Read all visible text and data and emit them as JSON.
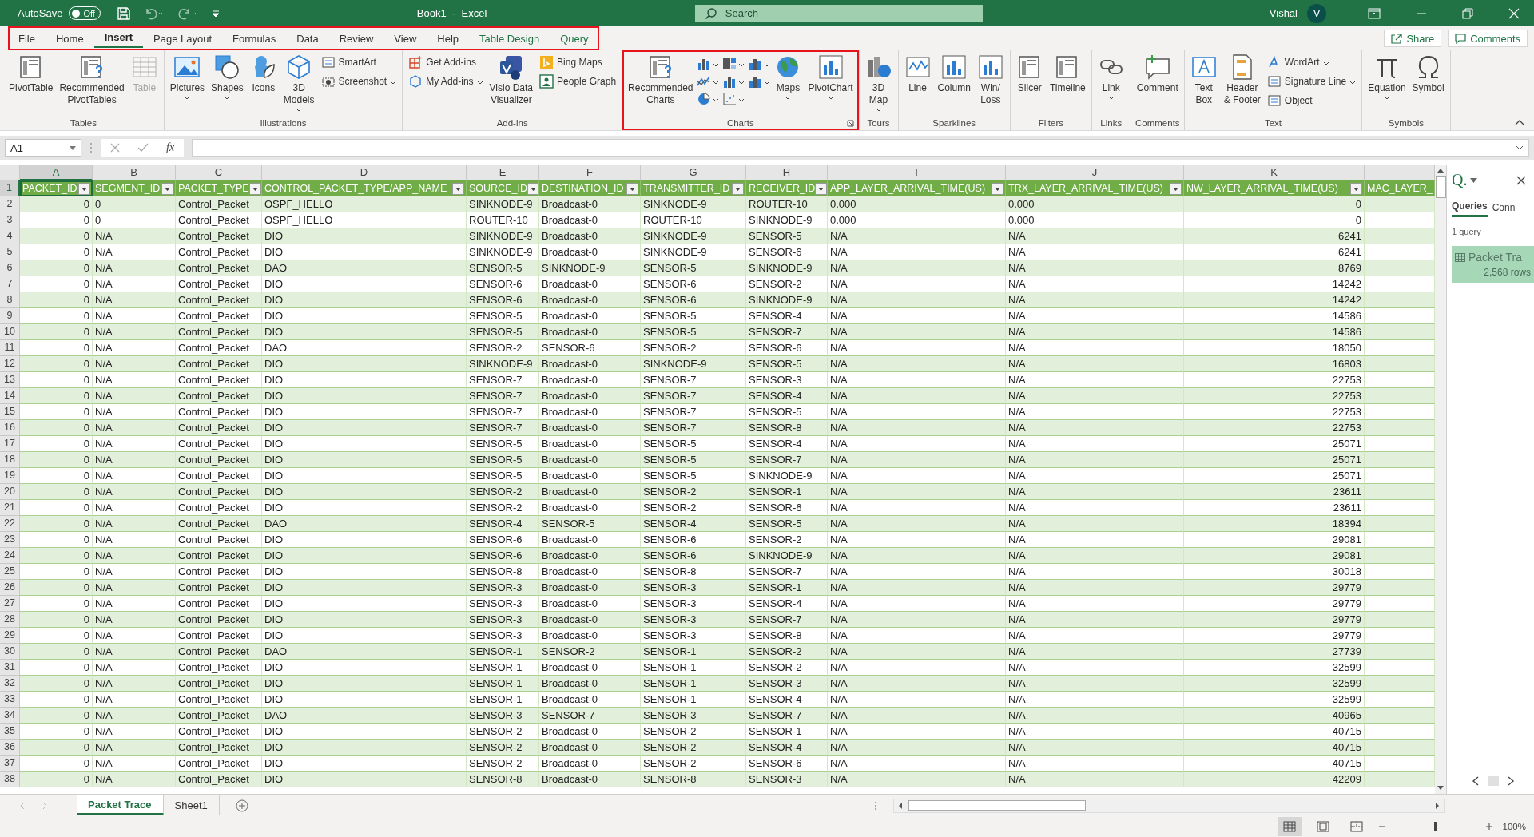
{
  "title_bar": {
    "autosave_label": "AutoSave",
    "autosave": {
      "on": false,
      "label": "Off"
    },
    "title": "Book1  -  Excel",
    "search_placeholder": "Search",
    "user": "Vishal",
    "avatar": "V"
  },
  "ribbon_tabs": {
    "highlighted": true,
    "items": [
      {
        "label": "File",
        "selected": false,
        "contextual": false
      },
      {
        "label": "Home",
        "selected": false,
        "contextual": false
      },
      {
        "label": "Insert",
        "selected": true,
        "contextual": false
      },
      {
        "label": "Page Layout",
        "selected": false,
        "contextual": false
      },
      {
        "label": "Formulas",
        "selected": false,
        "contextual": false
      },
      {
        "label": "Data",
        "selected": false,
        "contextual": false
      },
      {
        "label": "Review",
        "selected": false,
        "contextual": false
      },
      {
        "label": "View",
        "selected": false,
        "contextual": false
      },
      {
        "label": "Help",
        "selected": false,
        "contextual": false
      },
      {
        "label": "Table Design",
        "selected": false,
        "contextual": true
      },
      {
        "label": "Query",
        "selected": false,
        "contextual": true
      }
    ]
  },
  "share_button": "Share",
  "comments_button": "Comments",
  "ribbon": {
    "groups": [
      {
        "label": "Tables",
        "highlighted": false,
        "blocks": [
          {
            "kind": "large",
            "label": "PivotTable",
            "dropdown": false,
            "disabled": false
          },
          {
            "kind": "large",
            "label": "Recommended\nPivotTables",
            "dropdown": false,
            "disabled": false
          },
          {
            "kind": "large",
            "label": "Table",
            "dropdown": false,
            "disabled": true
          }
        ]
      },
      {
        "label": "Illustrations",
        "highlighted": false,
        "blocks": [
          {
            "kind": "large",
            "label": "Pictures",
            "dropdown": true,
            "disabled": false
          },
          {
            "kind": "large",
            "label": "Shapes",
            "dropdown": true,
            "disabled": false
          },
          {
            "kind": "large",
            "label": "Icons",
            "dropdown": false,
            "disabled": false
          },
          {
            "kind": "large",
            "label": "3D\nModels",
            "dropdown": true,
            "disabled": false
          },
          {
            "kind": "stack",
            "items": [
              {
                "label": "SmartArt",
                "dropdown": false
              },
              {
                "label": "Screenshot",
                "dropdown": true
              }
            ]
          }
        ]
      },
      {
        "label": "Add-ins",
        "highlighted": false,
        "blocks": [
          {
            "kind": "stack",
            "items": [
              {
                "label": "Get Add-ins",
                "dropdown": false
              },
              {
                "label": "My Add-ins",
                "dropdown": true
              }
            ]
          },
          {
            "kind": "large",
            "label": "Visio Data\nVisualizer",
            "dropdown": false,
            "disabled": false
          },
          {
            "kind": "stack",
            "items": [
              {
                "label": "Bing Maps",
                "dropdown": false
              },
              {
                "label": "People Graph",
                "dropdown": false
              }
            ]
          }
        ]
      },
      {
        "label": "Charts",
        "highlighted": true,
        "launcher": true,
        "blocks": [
          {
            "kind": "large",
            "label": "Recommended\nCharts",
            "dropdown": false,
            "disabled": false
          },
          {
            "kind": "icon_grid",
            "items": [
              {
                "dropdown": true
              },
              {
                "dropdown": true
              },
              {
                "dropdown": true
              },
              {
                "dropdown": true
              },
              {
                "dropdown": true
              },
              {
                "dropdown": true
              },
              {
                "dropdown": true
              },
              {
                "dropdown": true
              }
            ]
          },
          {
            "kind": "large",
            "label": "Maps",
            "dropdown": true,
            "disabled": false
          },
          {
            "kind": "large",
            "label": "PivotChart",
            "dropdown": true,
            "disabled": false
          }
        ]
      },
      {
        "label": "Tours",
        "highlighted": false,
        "blocks": [
          {
            "kind": "large",
            "label": "3D\nMap",
            "dropdown": true,
            "disabled": false
          }
        ]
      },
      {
        "label": "Sparklines",
        "highlighted": false,
        "blocks": [
          {
            "kind": "large",
            "label": "Line",
            "dropdown": false,
            "disabled": false
          },
          {
            "kind": "large",
            "label": "Column",
            "dropdown": false,
            "disabled": false
          },
          {
            "kind": "large",
            "label": "Win/\nLoss",
            "dropdown": false,
            "disabled": false
          }
        ]
      },
      {
        "label": "Filters",
        "highlighted": false,
        "blocks": [
          {
            "kind": "large",
            "label": "Slicer",
            "dropdown": false,
            "disabled": false
          },
          {
            "kind": "large",
            "label": "Timeline",
            "dropdown": false,
            "disabled": false
          }
        ]
      },
      {
        "label": "Links",
        "highlighted": false,
        "blocks": [
          {
            "kind": "large",
            "label": "Link",
            "dropdown": true,
            "disabled": false
          }
        ]
      },
      {
        "label": "Comments",
        "highlighted": false,
        "blocks": [
          {
            "kind": "large",
            "label": "Comment",
            "dropdown": false,
            "disabled": false
          }
        ]
      },
      {
        "label": "Text",
        "highlighted": false,
        "blocks": [
          {
            "kind": "large",
            "label": "Text\nBox",
            "dropdown": false,
            "disabled": false
          },
          {
            "kind": "large",
            "label": "Header\n& Footer",
            "dropdown": false,
            "disabled": false
          },
          {
            "kind": "stack",
            "items": [
              {
                "label": "WordArt",
                "dropdown": true
              },
              {
                "label": "Signature Line",
                "dropdown": true
              },
              {
                "label": "Object",
                "dropdown": false
              }
            ]
          }
        ]
      },
      {
        "label": "Symbols",
        "highlighted": false,
        "blocks": [
          {
            "kind": "large",
            "label": "Equation",
            "dropdown": true,
            "disabled": false
          },
          {
            "kind": "large",
            "label": "Symbol",
            "dropdown": false,
            "disabled": false
          }
        ]
      }
    ]
  },
  "formula_bar": {
    "name_box": "A1",
    "fx": "fx"
  },
  "sheet": {
    "column_letters": [
      {
        "letter": "A",
        "selected": true
      },
      {
        "letter": "B",
        "selected": false
      },
      {
        "letter": "C",
        "selected": false
      },
      {
        "letter": "D",
        "selected": false
      },
      {
        "letter": "E",
        "selected": false
      },
      {
        "letter": "F",
        "selected": false
      },
      {
        "letter": "G",
        "selected": false
      },
      {
        "letter": "H",
        "selected": false
      },
      {
        "letter": "I",
        "selected": false
      },
      {
        "letter": "J",
        "selected": false
      },
      {
        "letter": "K",
        "selected": false
      }
    ],
    "columns": [
      {
        "name": "PACKET_ID",
        "numeric": true,
        "filter": true
      },
      {
        "name": "SEGMENT_ID",
        "numeric": false,
        "filter": true
      },
      {
        "name": "PACKET_TYPE",
        "numeric": false,
        "filter": true
      },
      {
        "name": "CONTROL_PACKET_TYPE/APP_NAME",
        "numeric": false,
        "filter": true
      },
      {
        "name": "SOURCE_ID",
        "numeric": false,
        "filter": true
      },
      {
        "name": "DESTINATION_ID",
        "numeric": false,
        "filter": true
      },
      {
        "name": "TRANSMITTER_ID",
        "numeric": false,
        "filter": true
      },
      {
        "name": "RECEIVER_ID",
        "numeric": false,
        "filter": true
      },
      {
        "name": "APP_LAYER_ARRIVAL_TIME(US)",
        "numeric": false,
        "filter": true
      },
      {
        "name": "TRX_LAYER_ARRIVAL_TIME(US)",
        "numeric": false,
        "filter": true
      },
      {
        "name": "NW_LAYER_ARRIVAL_TIME(US)",
        "numeric": true,
        "filter": true
      },
      {
        "name": "MAC_LAYER_",
        "filter": false
      }
    ],
    "header_row": {
      "number": "1",
      "selected": true
    },
    "rows": [
      {
        "number": "2",
        "cells": [
          "0",
          "0",
          "Control_Packet",
          "OSPF_HELLO",
          "SINKNODE-9",
          "Broadcast-0",
          "SINKNODE-9",
          "ROUTER-10",
          "0.000",
          "0.000",
          "0"
        ]
      },
      {
        "number": "3",
        "cells": [
          "0",
          "0",
          "Control_Packet",
          "OSPF_HELLO",
          "ROUTER-10",
          "Broadcast-0",
          "ROUTER-10",
          "SINKNODE-9",
          "0.000",
          "0.000",
          "0"
        ]
      },
      {
        "number": "4",
        "cells": [
          "0",
          "N/A",
          "Control_Packet",
          "DIO",
          "SINKNODE-9",
          "Broadcast-0",
          "SINKNODE-9",
          "SENSOR-5",
          "N/A",
          "N/A",
          "6241"
        ]
      },
      {
        "number": "5",
        "cells": [
          "0",
          "N/A",
          "Control_Packet",
          "DIO",
          "SINKNODE-9",
          "Broadcast-0",
          "SINKNODE-9",
          "SENSOR-6",
          "N/A",
          "N/A",
          "6241"
        ]
      },
      {
        "number": "6",
        "cells": [
          "0",
          "N/A",
          "Control_Packet",
          "DAO",
          "SENSOR-5",
          "SINKNODE-9",
          "SENSOR-5",
          "SINKNODE-9",
          "N/A",
          "N/A",
          "8769"
        ]
      },
      {
        "number": "7",
        "cells": [
          "0",
          "N/A",
          "Control_Packet",
          "DIO",
          "SENSOR-6",
          "Broadcast-0",
          "SENSOR-6",
          "SENSOR-2",
          "N/A",
          "N/A",
          "14242"
        ]
      },
      {
        "number": "8",
        "cells": [
          "0",
          "N/A",
          "Control_Packet",
          "DIO",
          "SENSOR-6",
          "Broadcast-0",
          "SENSOR-6",
          "SINKNODE-9",
          "N/A",
          "N/A",
          "14242"
        ]
      },
      {
        "number": "9",
        "cells": [
          "0",
          "N/A",
          "Control_Packet",
          "DIO",
          "SENSOR-5",
          "Broadcast-0",
          "SENSOR-5",
          "SENSOR-4",
          "N/A",
          "N/A",
          "14586"
        ]
      },
      {
        "number": "10",
        "cells": [
          "0",
          "N/A",
          "Control_Packet",
          "DIO",
          "SENSOR-5",
          "Broadcast-0",
          "SENSOR-5",
          "SENSOR-7",
          "N/A",
          "N/A",
          "14586"
        ]
      },
      {
        "number": "11",
        "cells": [
          "0",
          "N/A",
          "Control_Packet",
          "DAO",
          "SENSOR-2",
          "SENSOR-6",
          "SENSOR-2",
          "SENSOR-6",
          "N/A",
          "N/A",
          "18050"
        ]
      },
      {
        "number": "12",
        "cells": [
          "0",
          "N/A",
          "Control_Packet",
          "DIO",
          "SINKNODE-9",
          "Broadcast-0",
          "SINKNODE-9",
          "SENSOR-5",
          "N/A",
          "N/A",
          "16803"
        ]
      },
      {
        "number": "13",
        "cells": [
          "0",
          "N/A",
          "Control_Packet",
          "DIO",
          "SENSOR-7",
          "Broadcast-0",
          "SENSOR-7",
          "SENSOR-3",
          "N/A",
          "N/A",
          "22753"
        ]
      },
      {
        "number": "14",
        "cells": [
          "0",
          "N/A",
          "Control_Packet",
          "DIO",
          "SENSOR-7",
          "Broadcast-0",
          "SENSOR-7",
          "SENSOR-4",
          "N/A",
          "N/A",
          "22753"
        ]
      },
      {
        "number": "15",
        "cells": [
          "0",
          "N/A",
          "Control_Packet",
          "DIO",
          "SENSOR-7",
          "Broadcast-0",
          "SENSOR-7",
          "SENSOR-5",
          "N/A",
          "N/A",
          "22753"
        ]
      },
      {
        "number": "16",
        "cells": [
          "0",
          "N/A",
          "Control_Packet",
          "DIO",
          "SENSOR-7",
          "Broadcast-0",
          "SENSOR-7",
          "SENSOR-8",
          "N/A",
          "N/A",
          "22753"
        ]
      },
      {
        "number": "17",
        "cells": [
          "0",
          "N/A",
          "Control_Packet",
          "DIO",
          "SENSOR-5",
          "Broadcast-0",
          "SENSOR-5",
          "SENSOR-4",
          "N/A",
          "N/A",
          "25071"
        ]
      },
      {
        "number": "18",
        "cells": [
          "0",
          "N/A",
          "Control_Packet",
          "DIO",
          "SENSOR-5",
          "Broadcast-0",
          "SENSOR-5",
          "SENSOR-7",
          "N/A",
          "N/A",
          "25071"
        ]
      },
      {
        "number": "19",
        "cells": [
          "0",
          "N/A",
          "Control_Packet",
          "DIO",
          "SENSOR-5",
          "Broadcast-0",
          "SENSOR-5",
          "SINKNODE-9",
          "N/A",
          "N/A",
          "25071"
        ]
      },
      {
        "number": "20",
        "cells": [
          "0",
          "N/A",
          "Control_Packet",
          "DIO",
          "SENSOR-2",
          "Broadcast-0",
          "SENSOR-2",
          "SENSOR-1",
          "N/A",
          "N/A",
          "23611"
        ]
      },
      {
        "number": "21",
        "cells": [
          "0",
          "N/A",
          "Control_Packet",
          "DIO",
          "SENSOR-2",
          "Broadcast-0",
          "SENSOR-2",
          "SENSOR-6",
          "N/A",
          "N/A",
          "23611"
        ]
      },
      {
        "number": "22",
        "cells": [
          "0",
          "N/A",
          "Control_Packet",
          "DAO",
          "SENSOR-4",
          "SENSOR-5",
          "SENSOR-4",
          "SENSOR-5",
          "N/A",
          "N/A",
          "18394"
        ]
      },
      {
        "number": "23",
        "cells": [
          "0",
          "N/A",
          "Control_Packet",
          "DIO",
          "SENSOR-6",
          "Broadcast-0",
          "SENSOR-6",
          "SENSOR-2",
          "N/A",
          "N/A",
          "29081"
        ]
      },
      {
        "number": "24",
        "cells": [
          "0",
          "N/A",
          "Control_Packet",
          "DIO",
          "SENSOR-6",
          "Broadcast-0",
          "SENSOR-6",
          "SINKNODE-9",
          "N/A",
          "N/A",
          "29081"
        ]
      },
      {
        "number": "25",
        "cells": [
          "0",
          "N/A",
          "Control_Packet",
          "DIO",
          "SENSOR-8",
          "Broadcast-0",
          "SENSOR-8",
          "SENSOR-7",
          "N/A",
          "N/A",
          "30018"
        ]
      },
      {
        "number": "26",
        "cells": [
          "0",
          "N/A",
          "Control_Packet",
          "DIO",
          "SENSOR-3",
          "Broadcast-0",
          "SENSOR-3",
          "SENSOR-1",
          "N/A",
          "N/A",
          "29779"
        ]
      },
      {
        "number": "27",
        "cells": [
          "0",
          "N/A",
          "Control_Packet",
          "DIO",
          "SENSOR-3",
          "Broadcast-0",
          "SENSOR-3",
          "SENSOR-4",
          "N/A",
          "N/A",
          "29779"
        ]
      },
      {
        "number": "28",
        "cells": [
          "0",
          "N/A",
          "Control_Packet",
          "DIO",
          "SENSOR-3",
          "Broadcast-0",
          "SENSOR-3",
          "SENSOR-7",
          "N/A",
          "N/A",
          "29779"
        ]
      },
      {
        "number": "29",
        "cells": [
          "0",
          "N/A",
          "Control_Packet",
          "DIO",
          "SENSOR-3",
          "Broadcast-0",
          "SENSOR-3",
          "SENSOR-8",
          "N/A",
          "N/A",
          "29779"
        ]
      },
      {
        "number": "30",
        "cells": [
          "0",
          "N/A",
          "Control_Packet",
          "DAO",
          "SENSOR-1",
          "SENSOR-2",
          "SENSOR-1",
          "SENSOR-2",
          "N/A",
          "N/A",
          "27739"
        ]
      },
      {
        "number": "31",
        "cells": [
          "0",
          "N/A",
          "Control_Packet",
          "DIO",
          "SENSOR-1",
          "Broadcast-0",
          "SENSOR-1",
          "SENSOR-2",
          "N/A",
          "N/A",
          "32599"
        ]
      },
      {
        "number": "32",
        "cells": [
          "0",
          "N/A",
          "Control_Packet",
          "DIO",
          "SENSOR-1",
          "Broadcast-0",
          "SENSOR-1",
          "SENSOR-3",
          "N/A",
          "N/A",
          "32599"
        ]
      },
      {
        "number": "33",
        "cells": [
          "0",
          "N/A",
          "Control_Packet",
          "DIO",
          "SENSOR-1",
          "Broadcast-0",
          "SENSOR-1",
          "SENSOR-4",
          "N/A",
          "N/A",
          "32599"
        ]
      },
      {
        "number": "34",
        "cells": [
          "0",
          "N/A",
          "Control_Packet",
          "DAO",
          "SENSOR-3",
          "SENSOR-7",
          "SENSOR-3",
          "SENSOR-7",
          "N/A",
          "N/A",
          "40965"
        ]
      },
      {
        "number": "35",
        "cells": [
          "0",
          "N/A",
          "Control_Packet",
          "DIO",
          "SENSOR-2",
          "Broadcast-0",
          "SENSOR-2",
          "SENSOR-1",
          "N/A",
          "N/A",
          "40715"
        ]
      },
      {
        "number": "36",
        "cells": [
          "0",
          "N/A",
          "Control_Packet",
          "DIO",
          "SENSOR-2",
          "Broadcast-0",
          "SENSOR-2",
          "SENSOR-4",
          "N/A",
          "N/A",
          "40715"
        ]
      },
      {
        "number": "37",
        "cells": [
          "0",
          "N/A",
          "Control_Packet",
          "DIO",
          "SENSOR-2",
          "Broadcast-0",
          "SENSOR-2",
          "SENSOR-6",
          "N/A",
          "N/A",
          "40715"
        ]
      },
      {
        "number": "38",
        "cells": [
          "0",
          "N/A",
          "Control_Packet",
          "DIO",
          "SENSOR-8",
          "Broadcast-0",
          "SENSOR-8",
          "SENSOR-3",
          "N/A",
          "N/A",
          "42209"
        ]
      }
    ]
  },
  "queries_pane": {
    "title": "Q.",
    "tabs": [
      {
        "label": "Queries",
        "selected": true
      },
      {
        "label": "Conn",
        "selected": false
      }
    ],
    "count": "1 query",
    "items": [
      {
        "name": "Packet Tra",
        "rows": "2,568 rows"
      }
    ]
  },
  "sheet_tabs": [
    {
      "label": "Packet Trace",
      "selected": true
    },
    {
      "label": "Sheet1",
      "selected": false
    }
  ],
  "status_bar": {
    "views": [
      {
        "selected": true
      },
      {
        "selected": false
      },
      {
        "selected": false
      }
    ],
    "zoom": {
      "level": 0.5,
      "reading": "100%"
    }
  }
}
